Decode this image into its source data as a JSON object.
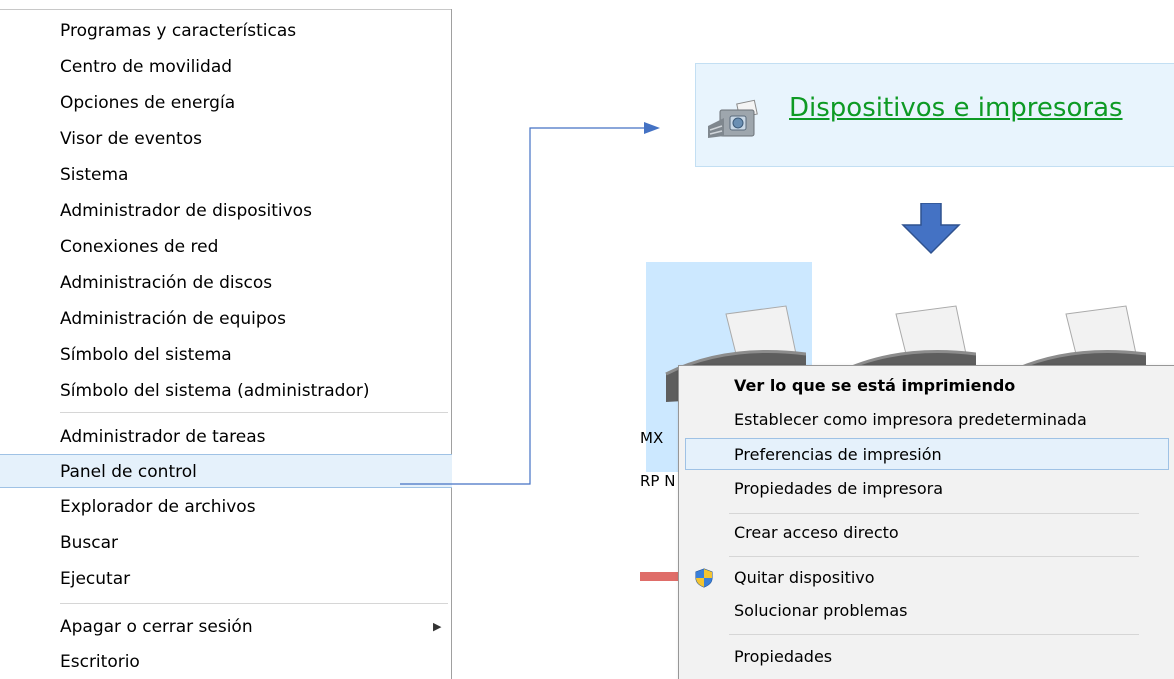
{
  "winx_menu": {
    "items": [
      {
        "label": "Programas y características"
      },
      {
        "label": "Centro de movilidad"
      },
      {
        "label": "Opciones de energía"
      },
      {
        "label": "Visor de eventos"
      },
      {
        "label": "Sistema"
      },
      {
        "label": "Administrador de dispositivos"
      },
      {
        "label": "Conexiones de red"
      },
      {
        "label": "Administración de discos"
      },
      {
        "label": "Administración de equipos"
      },
      {
        "label": "Símbolo del sistema"
      },
      {
        "label": "Símbolo del sistema (administrador)"
      },
      {
        "label": "Administrador de tareas"
      },
      {
        "label": "Panel de control",
        "selected": true
      },
      {
        "label": "Explorador de archivos"
      },
      {
        "label": "Buscar"
      },
      {
        "label": "Ejecutar"
      },
      {
        "label": "Apagar o cerrar sesión",
        "has_submenu": true
      },
      {
        "label": "Escritorio"
      }
    ],
    "submenu_arrow_icon": "chevron-right-icon"
  },
  "devices_banner": {
    "icon": "devices-printers-icon",
    "link_text": "Dispositivos e impresoras",
    "link_color": "#0e9a24"
  },
  "printers": {
    "tiles": [
      {
        "icon": "printer-icon",
        "selected": true
      },
      {
        "icon": "printer-icon"
      },
      {
        "icon": "printer-icon"
      }
    ],
    "label_partial_1": "MX",
    "label_partial_2": "RP N"
  },
  "context_menu": {
    "items": [
      {
        "label": "Ver lo que se está imprimiendo",
        "bold": true
      },
      {
        "label": "Establecer como impresora predeterminada"
      },
      {
        "label": "Preferencias de impresión",
        "selected": true
      },
      {
        "label": "Propiedades de impresora"
      },
      {
        "label": "Crear acceso directo"
      },
      {
        "label": "Quitar dispositivo",
        "icon": "uac-shield-icon"
      },
      {
        "label": "Solucionar problemas"
      },
      {
        "label": "Propiedades"
      }
    ]
  },
  "colors": {
    "selection_bg": "#e5f1fb",
    "selection_border": "#9fc2e5",
    "arrow_blue": "#4472c4"
  }
}
